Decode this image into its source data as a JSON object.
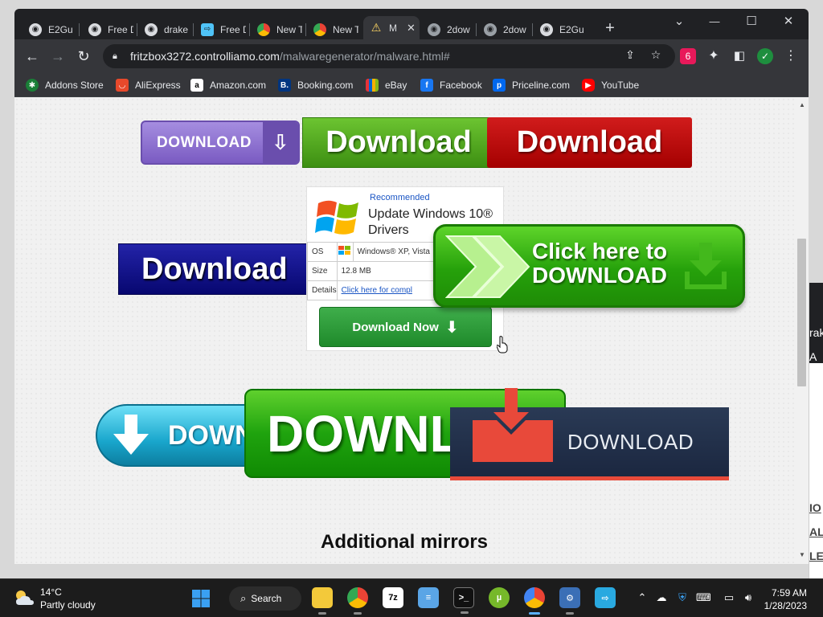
{
  "tabs": [
    {
      "title": "E2Gu",
      "icon": "globe-icon"
    },
    {
      "title": "Free D",
      "icon": "globe-icon"
    },
    {
      "title": "drake",
      "icon": "globe-icon"
    },
    {
      "title": "Free D",
      "icon": "share-icon"
    },
    {
      "title": "New T",
      "icon": "chrome-icon"
    },
    {
      "title": "New T",
      "icon": "chrome-icon"
    },
    {
      "title": "M",
      "icon": "warning-icon",
      "active": true
    },
    {
      "title": "2dow",
      "icon": "globe-icon"
    },
    {
      "title": "2dow",
      "icon": "globe-icon"
    },
    {
      "title": "E2Gu",
      "icon": "globe-icon"
    }
  ],
  "window_controls": {
    "tab_search": "⌄",
    "minimize": "—",
    "maximize": "☐",
    "close": "✕",
    "new_tab": "+"
  },
  "address": {
    "host": "fritzbox3272.controlliamo.com",
    "path": "/malwaregenerator/malware.html#"
  },
  "bookmarks": [
    {
      "label": "Addons Store",
      "icon": "puzzle-icon",
      "color": "#1a7f37"
    },
    {
      "label": "AliExpress",
      "icon": "aliexpress-icon",
      "color": "#e8492b"
    },
    {
      "label": "Amazon.com",
      "icon": "amazon-icon",
      "color": "#ffffff"
    },
    {
      "label": "Booking.com",
      "icon": "booking-icon",
      "color": "#003580"
    },
    {
      "label": "eBay",
      "icon": "ebay-icon",
      "color": "#e53238"
    },
    {
      "label": "Facebook",
      "icon": "facebook-icon",
      "color": "#1877f2"
    },
    {
      "label": "Priceline.com",
      "icon": "priceline-icon",
      "color": "#0068ef"
    },
    {
      "label": "YouTube",
      "icon": "youtube-icon",
      "color": "#ff0000"
    }
  ],
  "page": {
    "buttons": {
      "purple": "DOWNLOAD",
      "green_top": "Download",
      "red": "Download",
      "navy": "Download",
      "click_here_line1": "Click here to",
      "click_here_line2": "DOWNLOAD",
      "cyan": "DOWN",
      "big_green": "DOWNLO",
      "dark": "DOWNLOAD"
    },
    "ad": {
      "recommended": "Recommended",
      "title": "Update Windows 10® Drivers",
      "rows": [
        {
          "label": "OS",
          "value": "Windows® XP, Vista"
        },
        {
          "label": "Size",
          "value": "12.8 MB"
        },
        {
          "label": "Details",
          "value": "Click here for compl"
        }
      ],
      "download_now": "Download Now"
    },
    "mirrors_heading": "Additional mirrors"
  },
  "sliver_text": [
    "rak",
    "A",
    "IO",
    "AL",
    "LE"
  ],
  "taskbar": {
    "weather_temp": "14°C",
    "weather_desc": "Partly cloudy",
    "search_label": "Search",
    "time": "7:59 AM",
    "date": "1/28/2023",
    "apps": [
      {
        "name": "file-explorer-icon",
        "label": ""
      },
      {
        "name": "chrome-icon",
        "label": ""
      },
      {
        "name": "7zip-icon",
        "label": "7z"
      },
      {
        "name": "notepad-icon",
        "label": ""
      },
      {
        "name": "terminal-icon",
        "label": ""
      },
      {
        "name": "utorrent-icon",
        "label": ""
      },
      {
        "name": "chrome-alt-icon",
        "label": ""
      },
      {
        "name": "network-tool-icon",
        "label": ""
      },
      {
        "name": "remote-icon",
        "label": ""
      }
    ]
  },
  "colors": {
    "chrome_bg": "#202124",
    "toolbar_bg": "#35363a",
    "accent_red": "#e84a3a"
  }
}
